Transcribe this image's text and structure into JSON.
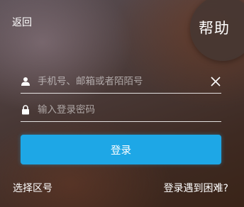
{
  "header": {
    "back_label": "返回",
    "help_label": "帮助"
  },
  "form": {
    "account": {
      "icon": "person-icon",
      "placeholder": "手机号、邮箱或者陌陌号",
      "value": ""
    },
    "password": {
      "icon": "lock-icon",
      "placeholder": "输入登录密码",
      "value": ""
    },
    "clear_icon": "close-icon",
    "login_label": "登录"
  },
  "footer": {
    "select_region_label": "选择区号",
    "trouble_label": "登录遇到困难?"
  },
  "colors": {
    "accent": "#1ea7e6",
    "text": "#ffffff"
  }
}
